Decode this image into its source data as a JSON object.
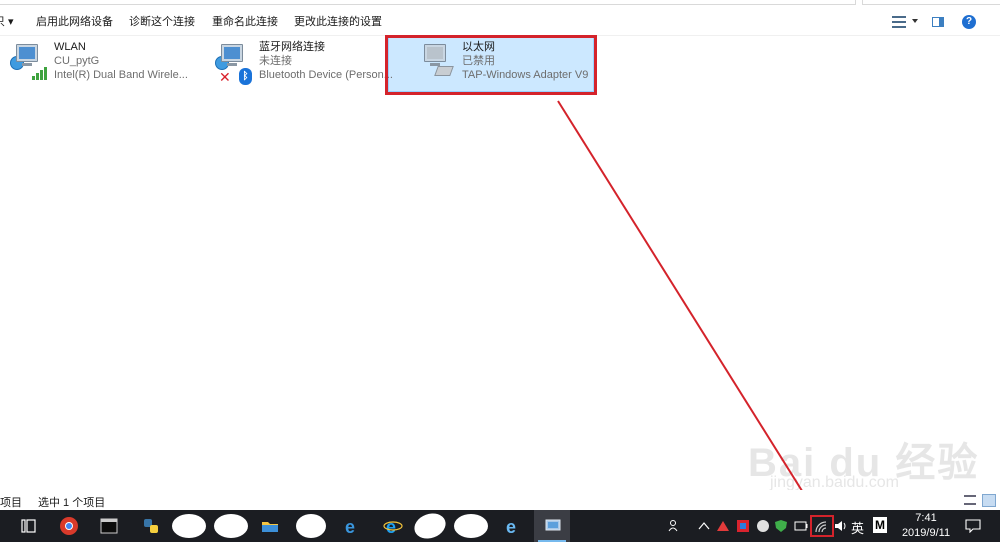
{
  "toolbar": {
    "truncated_label": "只 ▾",
    "enable_device": "启用此网络设备",
    "diagnose": "诊断这个连接",
    "rename": "重命名此连接",
    "change_settings": "更改此连接的设置",
    "help_glyph": "?"
  },
  "adapters": [
    {
      "name": "WLAN",
      "status": "CU_pytG",
      "device": "Intel(R) Dual Band Wirele..."
    },
    {
      "name": "蓝牙网络连接",
      "status": "未连接",
      "device": "Bluetooth Device (Person..."
    },
    {
      "name": "以太网",
      "status": "已禁用",
      "device": "TAP-Windows Adapter V9"
    }
  ],
  "statusbar": {
    "item_count": "项目",
    "selected": "选中 1 个项目"
  },
  "watermark": {
    "main": "Bai du 经验",
    "sub": "jingyan.baidu.com"
  },
  "taskbar": {
    "ime_label": "英",
    "ime_mode": "M",
    "time": "7:41",
    "date": "2019/9/11"
  },
  "colors": {
    "selection_bg": "#cce8ff",
    "highlight_red": "#d4232b",
    "taskbar_bg": "#1b1d22"
  }
}
